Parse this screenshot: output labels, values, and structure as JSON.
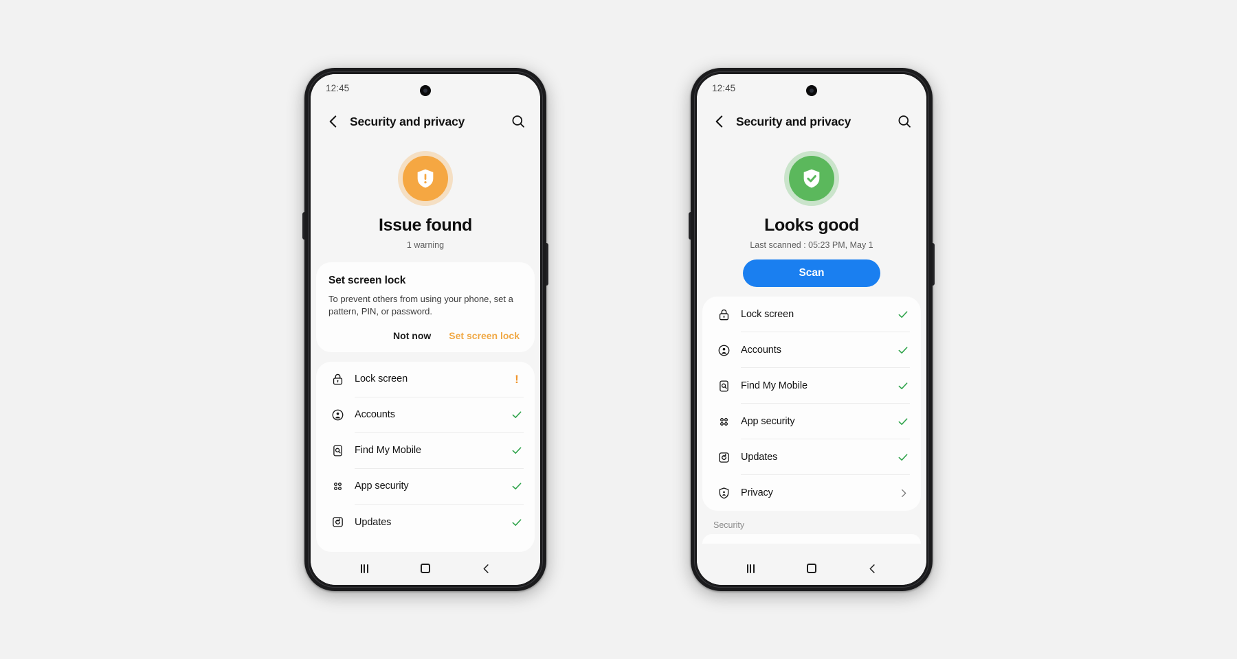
{
  "left_phone": {
    "status_bar": {
      "time": "12:45"
    },
    "app_bar": {
      "back_icon": "chevron-left-icon",
      "title": "Security and privacy",
      "search_icon": "search-icon"
    },
    "hero": {
      "shield_icon": "shield-warning-icon",
      "shield_color": "#F5A742",
      "title": "Issue found",
      "subtitle": "1 warning"
    },
    "warning_card": {
      "title": "Set screen lock",
      "description": "To prevent others from using your phone, set a pattern, PIN, or password.",
      "not_now_label": "Not now",
      "set_lock_label": "Set screen lock",
      "accent_color": "#F0A844"
    },
    "list": [
      {
        "icon": "lock-icon",
        "label": "Lock screen",
        "status": "warning"
      },
      {
        "icon": "account-circle-icon",
        "label": "Accounts",
        "status": "ok"
      },
      {
        "icon": "find-my-mobile-icon",
        "label": "Find My Mobile",
        "status": "ok"
      },
      {
        "icon": "app-grid-icon",
        "label": "App security",
        "status": "ok"
      },
      {
        "icon": "updates-icon",
        "label": "Updates",
        "status": "ok"
      }
    ],
    "nav_bar": {
      "recents_icon": "recents-icon",
      "home_icon": "home-icon",
      "back_icon": "nav-back-icon"
    }
  },
  "right_phone": {
    "status_bar": {
      "time": "12:45"
    },
    "app_bar": {
      "back_icon": "chevron-left-icon",
      "title": "Security and privacy",
      "search_icon": "search-icon"
    },
    "hero": {
      "shield_icon": "shield-check-icon",
      "shield_color": "#5BB85C",
      "title": "Looks good",
      "subtitle": "Last scanned : 05:23 PM, May 1",
      "scan_label": "Scan",
      "scan_color": "#1A7FF0"
    },
    "list": [
      {
        "icon": "lock-icon",
        "label": "Lock screen",
        "status": "ok"
      },
      {
        "icon": "account-circle-icon",
        "label": "Accounts",
        "status": "ok"
      },
      {
        "icon": "find-my-mobile-icon",
        "label": "Find My Mobile",
        "status": "ok"
      },
      {
        "icon": "app-grid-icon",
        "label": "App security",
        "status": "ok"
      },
      {
        "icon": "updates-icon",
        "label": "Updates",
        "status": "ok"
      },
      {
        "icon": "privacy-shield-icon",
        "label": "Privacy",
        "status": "chevron"
      }
    ],
    "section_header": "Security",
    "nav_bar": {
      "recents_icon": "recents-icon",
      "home_icon": "home-icon",
      "back_icon": "nav-back-icon"
    }
  },
  "colors": {
    "check_green": "#2EA34A",
    "warn_orange": "#F0952C",
    "page_background": "#F2F2F2",
    "screen_background": "#F5F5F5",
    "card_background": "#FDFDFD"
  }
}
